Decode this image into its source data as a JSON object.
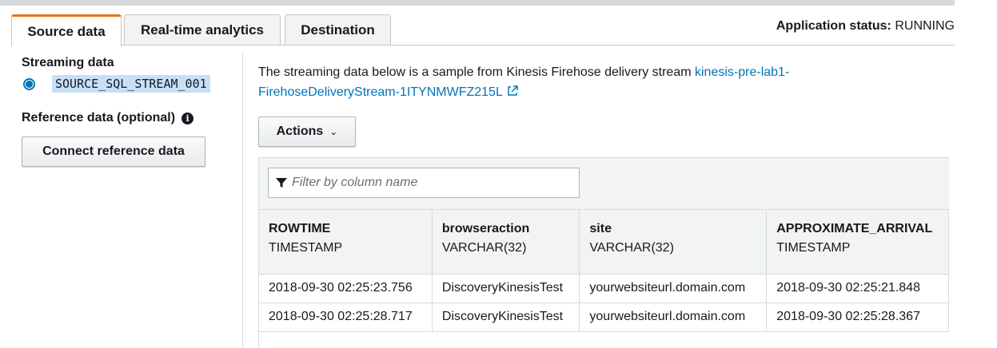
{
  "tabs": [
    {
      "label": "Source data",
      "active": true
    },
    {
      "label": "Real-time analytics",
      "active": false
    },
    {
      "label": "Destination",
      "active": false
    }
  ],
  "app_status": {
    "label": "Application status:",
    "value": "RUNNING"
  },
  "left": {
    "streaming_title": "Streaming data",
    "stream_name": "SOURCE_SQL_STREAM_001",
    "reference_title": "Reference data (optional)",
    "connect_button": "Connect reference data"
  },
  "description": {
    "text": "The streaming data below is a sample from Kinesis Firehose delivery stream ",
    "link": "kinesis-pre-lab1-FirehoseDeliveryStream-1ITYNMWFZ215L"
  },
  "actions_button": "Actions",
  "filter_placeholder": "Filter by column name",
  "table": {
    "columns": [
      {
        "name": "ROWTIME",
        "type": "TIMESTAMP"
      },
      {
        "name": "browseraction",
        "type": "VARCHAR(32)"
      },
      {
        "name": "site",
        "type": "VARCHAR(32)"
      },
      {
        "name": "APPROXIMATE_ARRIVAL",
        "type": "TIMESTAMP"
      }
    ],
    "rows": [
      [
        "2018-09-30 02:25:23.756",
        "DiscoveryKinesisTest",
        "yourwebsiteurl.domain.com",
        "2018-09-30 02:25:21.848"
      ],
      [
        "2018-09-30 02:25:28.717",
        "DiscoveryKinesisTest",
        "yourwebsiteurl.domain.com",
        "2018-09-30 02:25:28.367"
      ]
    ]
  },
  "colors": {
    "accent": "#ec7211",
    "link": "#0073bb"
  }
}
